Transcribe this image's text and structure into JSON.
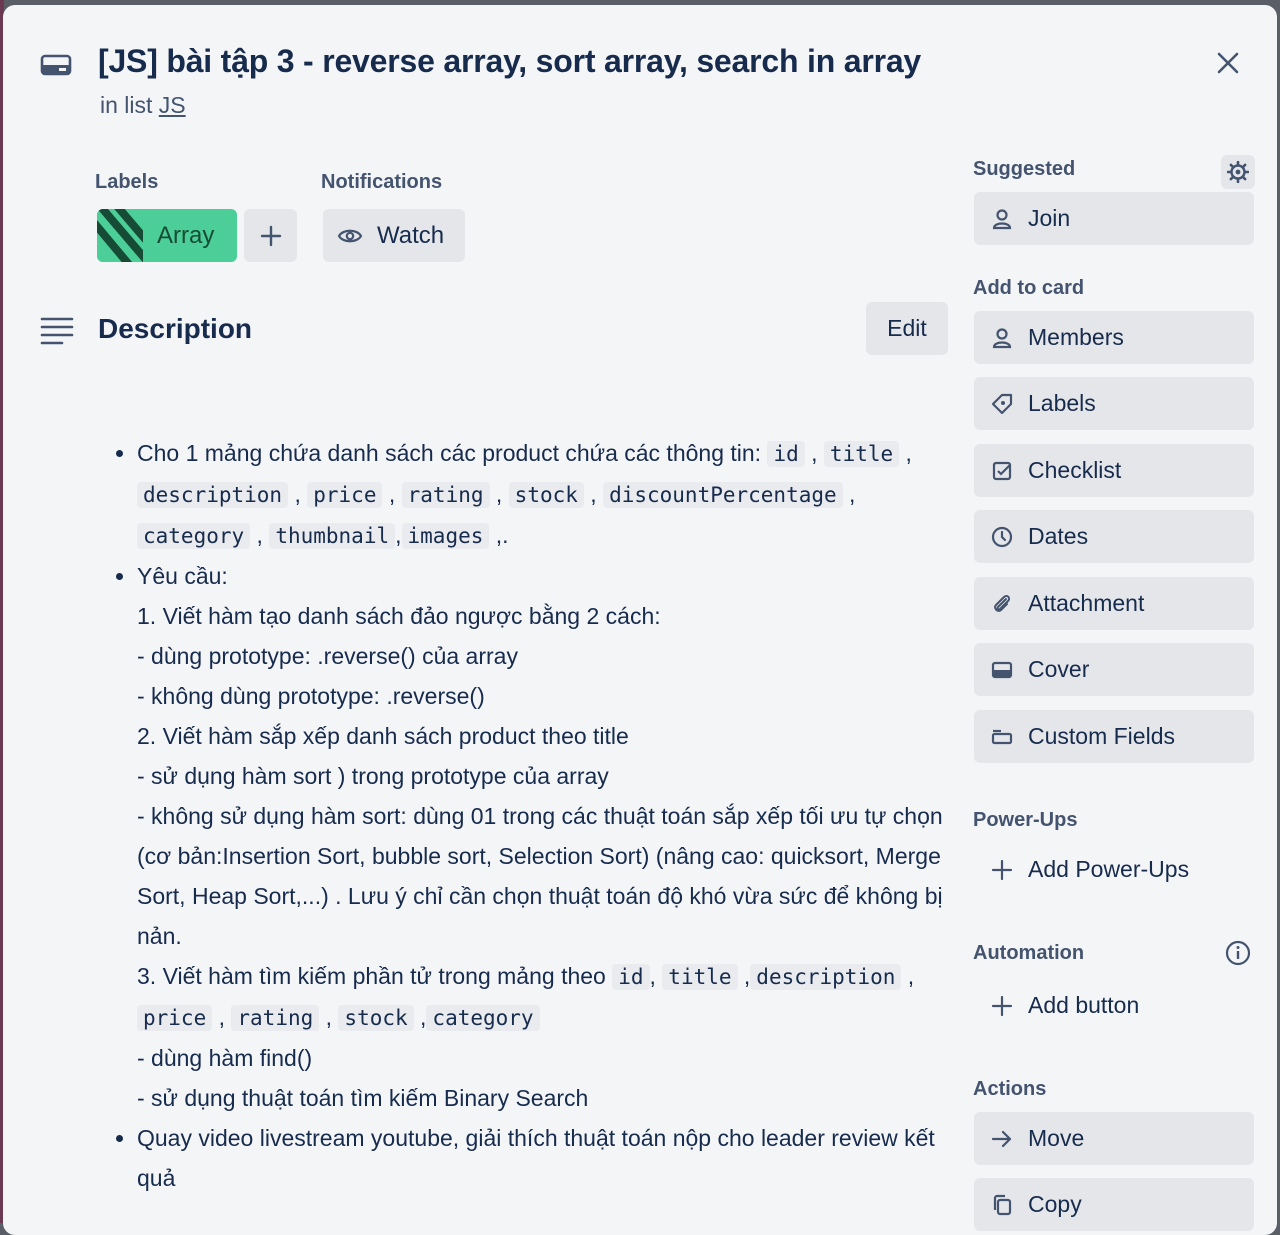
{
  "card": {
    "title": "[JS] bài tập 3 - reverse array, sort array, search in array",
    "in_list_prefix": "in list ",
    "list_name": "JS"
  },
  "labels": {
    "heading": "Labels",
    "items": [
      {
        "name": "Array",
        "color": "#4bce97"
      }
    ]
  },
  "notifications": {
    "heading": "Notifications",
    "watch_label": "Watch"
  },
  "description": {
    "heading": "Description",
    "edit_label": "Edit",
    "b1_text": "Cho 1 mảng chứa danh sách các product chứa các thông tin:",
    "b1_fields": [
      "id",
      "title",
      "description",
      "price",
      "rating",
      "stock",
      "discountPercentage",
      "category",
      "thumbnail",
      "images"
    ],
    "b1_tail": ",.",
    "b2_text": "Yêu cầu:",
    "l1": "1. Viết hàm tạo danh sách đảo ngược bằng 2 cách:",
    "l2": "- dùng prototype: .reverse() của array",
    "l3": "- không dùng prototype: .reverse()",
    "l4": "2. Viết hàm sắp xếp danh sách product theo title",
    "l5": "- sử dụng hàm sort ) trong prototype của array",
    "l6": "- không sử dụng hàm sort: dùng 01 trong các thuật toán sắp xếp tối ưu tự chọn (cơ bản:Insertion Sort, bubble sort, Selection Sort) (nâng cao: quicksort, Merge Sort, Heap Sort,...) . Lưu ý chỉ cần chọn thuật toán độ khó vừa sức để không bị nản.",
    "l7_text": "3. Viết hàm tìm kiếm phần tử trong mảng theo",
    "l7_fields": [
      "id",
      "title",
      "description",
      "price",
      "rating",
      "stock",
      "category"
    ],
    "l8": "- dùng hàm find()",
    "l9": "- sử dụng thuật toán tìm kiếm Binary Search",
    "b3_text": "Quay video livestream youtube, giải thích thuật toán nộp cho leader review kết quả"
  },
  "sidebar": {
    "suggested": {
      "heading": "Suggested",
      "join": "Join"
    },
    "add_to_card": {
      "heading": "Add to card",
      "members": "Members",
      "labels": "Labels",
      "checklist": "Checklist",
      "dates": "Dates",
      "attachment": "Attachment",
      "cover": "Cover",
      "custom_fields": "Custom Fields"
    },
    "power_ups": {
      "heading": "Power-Ups",
      "add": "Add Power-Ups"
    },
    "automation": {
      "heading": "Automation",
      "add": "Add button"
    },
    "actions": {
      "heading": "Actions",
      "move": "Move",
      "copy": "Copy"
    }
  }
}
